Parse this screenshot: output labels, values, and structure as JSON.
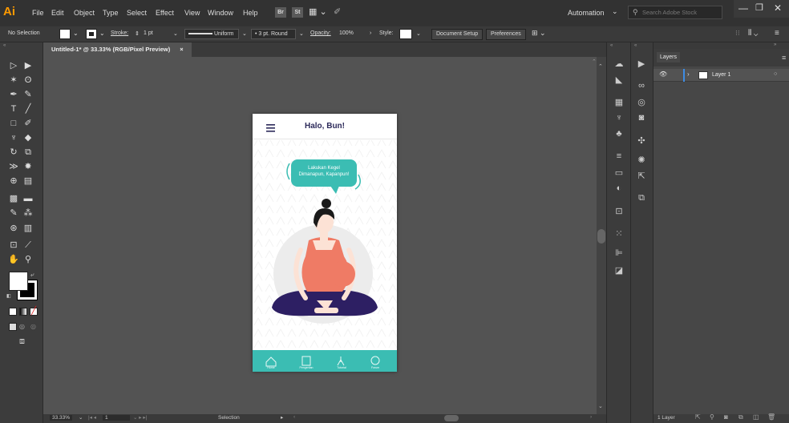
{
  "app": {
    "logo": "Ai",
    "menus": [
      "File",
      "Edit",
      "Object",
      "Type",
      "Select",
      "Effect",
      "View",
      "Window",
      "Help"
    ],
    "bridge_badge": "Br",
    "stock_badge": "St",
    "workspace": "Automation",
    "search_placeholder": "Search Adobe Stock"
  },
  "control_bar": {
    "selection_label": "No Selection",
    "stroke_label": "Stroke:",
    "stroke_value": "1 pt",
    "profile_value": "Uniform",
    "brush_value": "3 pt. Round",
    "opacity_label": "Opacity:",
    "opacity_value": "100%",
    "style_label": "Style:",
    "document_setup_label": "Document Setup",
    "preferences_label": "Preferences"
  },
  "document": {
    "tab_title": "Untitled-1* @ 33.33% (RGB/Pixel Preview)"
  },
  "statusbar": {
    "zoom": "33.33%",
    "artboard_number": "1",
    "tool": "Selection"
  },
  "artboard": {
    "header_title": "Halo, Bun!",
    "bubble_text_line1": "Lakukan Kegel",
    "bubble_text_line2": "Dimanapun, Kapanpun!",
    "nav_items": [
      "Home",
      "Pengertian",
      "Tutorial",
      "Forum"
    ],
    "colors": {
      "teal": "#3bbdb3",
      "title": "#2c2a5a",
      "dress": "#ef7b65",
      "pants": "#2d1f63",
      "hair": "#1a1a1a",
      "skin": "#fce2d5",
      "circle": "#ececec"
    }
  },
  "layers_panel": {
    "title": "Layers",
    "layer_name": "Layer 1",
    "layer_count": "1 Layer"
  }
}
